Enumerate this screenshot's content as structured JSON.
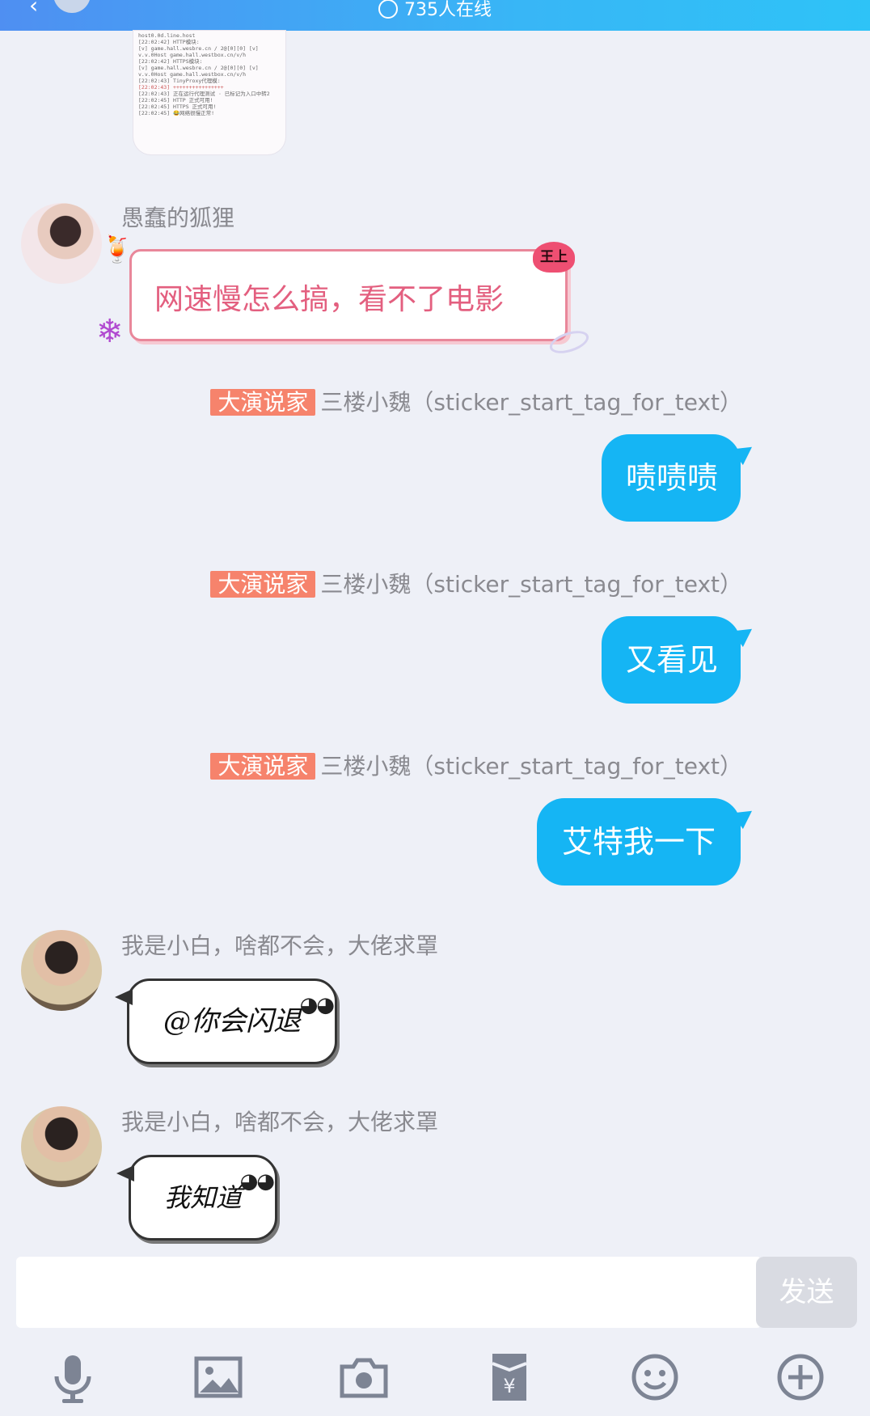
{
  "header": {
    "online_text": "735人在线"
  },
  "screenshot_lines": [
    "host0.0d.line.host",
    "",
    "[22:02:42] HTTP模块:",
    "[v] game.hall.wesbre.cn / 2@[0][0] [v]",
    "v.v.0Host game.hall.westbox.cn/v/h",
    "",
    "[22:02:42] HTTPS模块:",
    "[v] game.hall.wesbre.cn / 2@[0][0] [v]",
    "v.v.0Host game.hall.westbox.cn/v/h",
    "",
    "[22:02:43] TinyProxy代理模:",
    "[22:02:43] ++++++++++++++++",
    "[22:02:43] 正在运行代理测试 · 已标记为入口中转2",
    "[22:02:45] HTTP 正式可用!",
    "[22:02:45] HTTPS 正式可用!",
    "[22:02:45] 😂网络很慢正常!"
  ],
  "messages": [
    {
      "nick": "愚蠢的狐狸",
      "text": "网速慢怎么搞，看不了电影",
      "badge": "王上"
    },
    {
      "badge": "大演说家",
      "sender": "三楼小魏（sticker_start_tag_for_text）",
      "text": "啧啧啧"
    },
    {
      "badge": "大演说家",
      "sender": "三楼小魏（sticker_start_tag_for_text）",
      "text": "又看见"
    },
    {
      "badge": "大演说家",
      "sender": "三楼小魏（sticker_start_tag_for_text）",
      "text": "艾特我一下"
    },
    {
      "nick": "我是小白，啥都不会，大佬求罩",
      "text": "@你会闪退"
    },
    {
      "nick": "我是小白，啥都不会，大佬求罩",
      "text": "我知道"
    }
  ],
  "input": {
    "value": "",
    "send_label": "发送"
  },
  "toolbar": [
    "mic-icon",
    "image-icon",
    "camera-icon",
    "red-packet-icon",
    "emoji-icon",
    "plus-icon"
  ]
}
